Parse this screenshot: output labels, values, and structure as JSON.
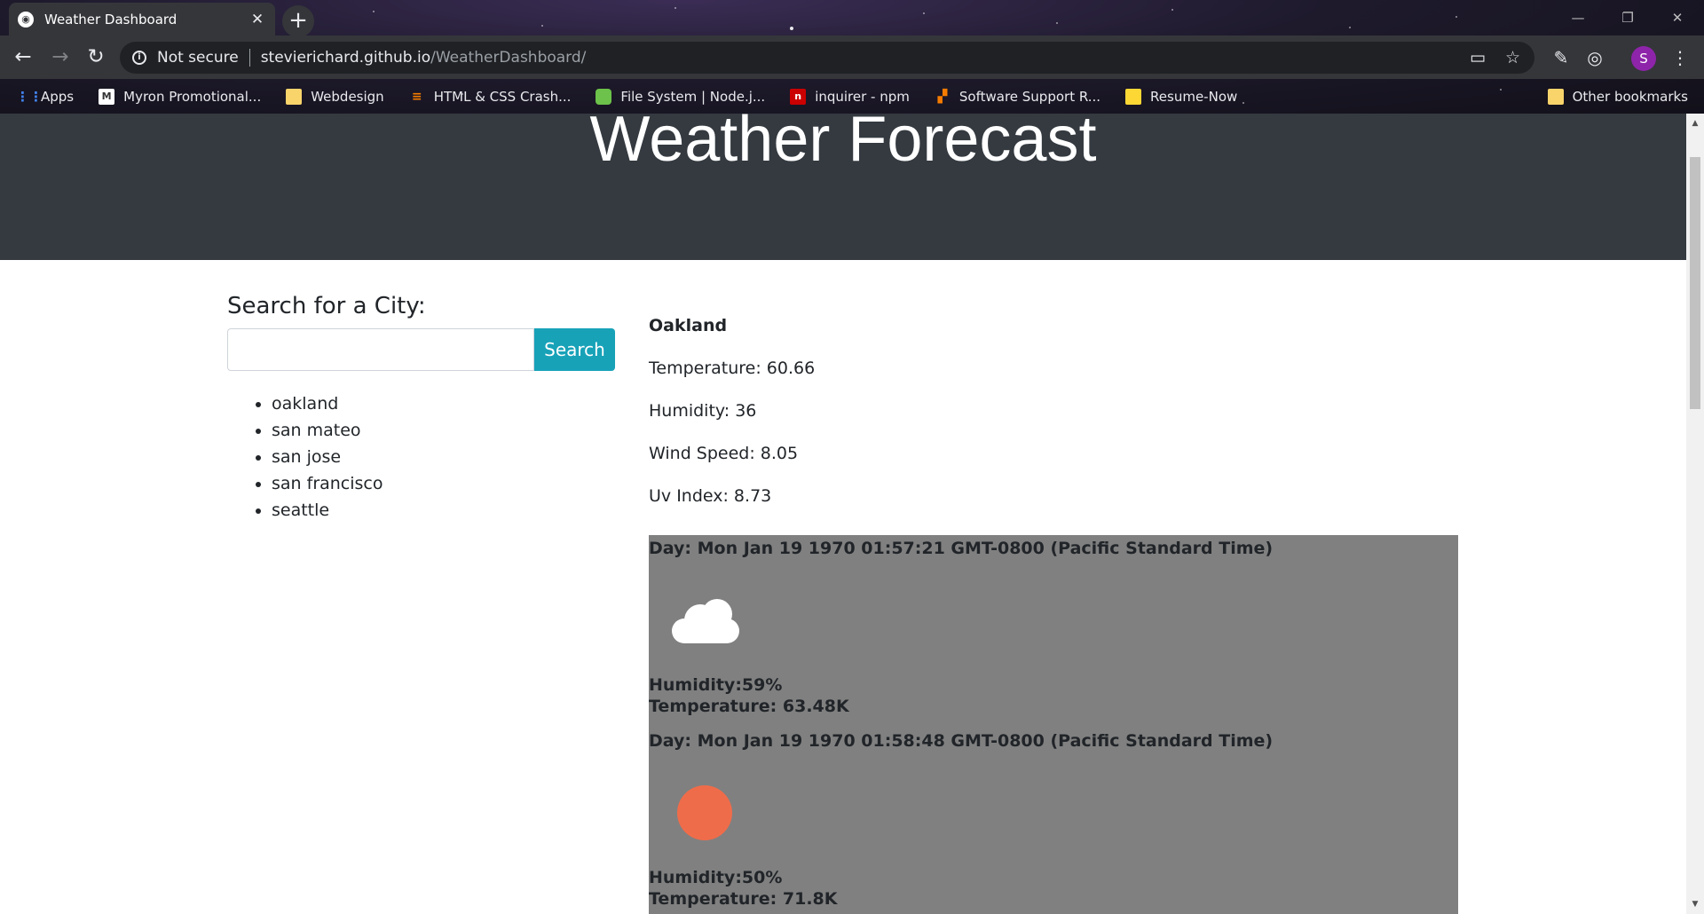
{
  "browser": {
    "tab_title": "Weather Dashboard",
    "new_tab_symbol": "+",
    "close_symbol": "✕",
    "security_label": "Not secure",
    "url_host": "stevierichard.github.io",
    "url_path": "/WeatherDashboard/",
    "profile_initial": "S",
    "bookmarks": [
      {
        "label": "Apps",
        "icon": "apps-grid-icon",
        "color": "#4285f4"
      },
      {
        "label": "Myron Promotional...",
        "icon": "myron-icon",
        "color": "#ffffff"
      },
      {
        "label": "Webdesign",
        "icon": "folder-icon",
        "color": "#f9d46b"
      },
      {
        "label": "HTML & CSS Crash...",
        "icon": "html-css-icon",
        "color": "#f57c00"
      },
      {
        "label": "File System | Node.j...",
        "icon": "nodejs-icon",
        "color": "#6cc24a"
      },
      {
        "label": "inquirer - npm",
        "icon": "npm-icon",
        "color": "#cb0000"
      },
      {
        "label": "Software Support R...",
        "icon": "software-icon",
        "color": "#f57c00"
      },
      {
        "label": "Resume-Now",
        "icon": "resume-now-icon",
        "color": "#fdd835"
      }
    ],
    "other_bookmarks": "Other bookmarks"
  },
  "header": {
    "title": "Weather Forecast"
  },
  "search": {
    "heading": "Search for a City:",
    "input_value": "",
    "button_label": "Search",
    "history": [
      "oakland",
      "san mateo",
      "san jose",
      "san francisco",
      "seattle"
    ]
  },
  "current": {
    "city": "Oakland",
    "temperature": "Temperature: 60.66",
    "humidity": "Humidity: 36",
    "wind_speed": "Wind Speed: 8.05",
    "uv_index": "Uv Index: 8.73"
  },
  "forecast": [
    {
      "day": "Day: Mon Jan 19 1970 01:57:21 GMT-0800 (Pacific Standard Time)",
      "icon": "cloud-icon",
      "humidity": "Humidity:59%",
      "temperature": "Temperature: 63.48K"
    },
    {
      "day": "Day: Mon Jan 19 1970 01:58:48 GMT-0800 (Pacific Standard Time)",
      "icon": "sun-icon",
      "humidity": "Humidity:50%",
      "temperature": "Temperature: 71.8K"
    }
  ],
  "colors": {
    "header_bg": "#343a40",
    "button_bg": "#17a2b8",
    "forecast_bg": "#808080",
    "sun": "#ef6c4a"
  }
}
